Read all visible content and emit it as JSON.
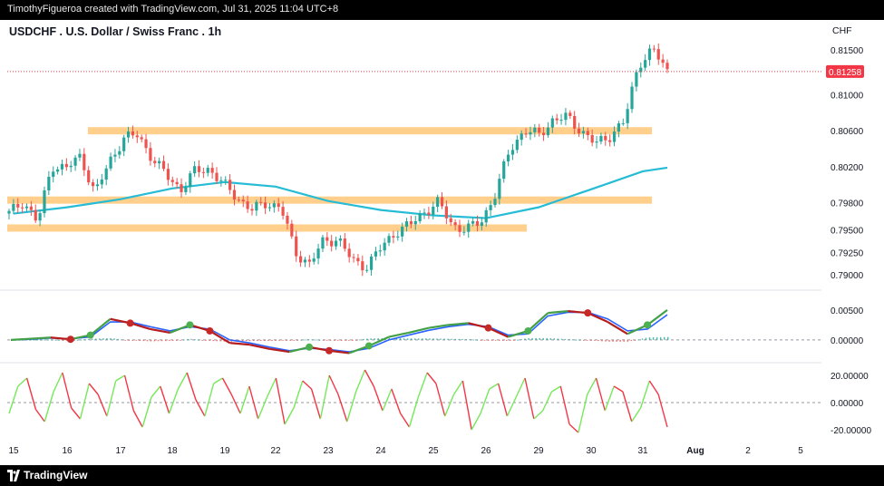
{
  "header": {
    "attribution": "TimothyFigueroa created with TradingView.com, Jul 31, 2025 11:04 UTC+8"
  },
  "footer": {
    "brand": "TradingView"
  },
  "colors": {
    "up": "#26a69a",
    "down": "#ef5350",
    "ma": "#26bcd5",
    "zone": "#ffc777",
    "last_price": "#f23645",
    "macd_fast": "#43a047",
    "macd_slow": "#2962ff",
    "osc_up": "#76e85a",
    "osc_down": "#f23645"
  },
  "chart_data": [
    {
      "type": "candlestick",
      "title": "USDCHF . U.S. Dollar / Swiss Franc . 1h",
      "currency": "CHF",
      "last_price": "0.81258",
      "x_ticks": [
        "15",
        "16",
        "17",
        "18",
        "19",
        "22",
        "23",
        "24",
        "25",
        "26",
        "29",
        "30",
        "31",
        "Aug",
        "2",
        "5"
      ],
      "y_ticks": [
        "0.81500",
        "0.81000",
        "0.80600",
        "0.80200",
        "0.79800",
        "0.79500",
        "0.79250",
        "0.79000"
      ],
      "ylim": [
        0.7885,
        0.817
      ],
      "grid": false,
      "price_path": [
        [
          "15",
          0.7968
        ],
        [
          "15",
          0.7982
        ],
        [
          "16",
          0.7958
        ],
        [
          "16",
          0.8022
        ],
        [
          "16",
          0.8018
        ],
        [
          "17",
          0.8032
        ],
        [
          "17",
          0.799
        ],
        [
          "17",
          0.8025
        ],
        [
          "18",
          0.8052
        ],
        [
          "18",
          0.8055
        ],
        [
          "18",
          0.803
        ],
        [
          "19",
          0.801
        ],
        [
          "19",
          0.7995
        ],
        [
          "19",
          0.8015
        ],
        [
          "19",
          0.8018
        ],
        [
          "22",
          0.8
        ],
        [
          "22",
          0.7985
        ],
        [
          "22",
          0.7972
        ],
        [
          "22",
          0.798
        ],
        [
          "22",
          0.7975
        ],
        [
          "23",
          0.7925
        ],
        [
          "23",
          0.7912
        ],
        [
          "23",
          0.7938
        ],
        [
          "24",
          0.794
        ],
        [
          "24",
          0.7915
        ],
        [
          "24",
          0.791
        ],
        [
          "25",
          0.793
        ],
        [
          "25",
          0.7948
        ],
        [
          "25",
          0.7955
        ],
        [
          "25",
          0.797
        ],
        [
          "26",
          0.798
        ],
        [
          "26",
          0.7955
        ],
        [
          "26",
          0.795
        ],
        [
          "26",
          0.796
        ],
        [
          "26",
          0.799
        ],
        [
          "29",
          0.804
        ],
        [
          "29",
          0.806
        ],
        [
          "29",
          0.8055
        ],
        [
          "29",
          0.8072
        ],
        [
          "30",
          0.8075
        ],
        [
          "30",
          0.806
        ],
        [
          "30",
          0.8045
        ],
        [
          "30",
          0.8055
        ],
        [
          "31",
          0.807
        ],
        [
          "31",
          0.8135
        ],
        [
          "31",
          0.815
        ],
        [
          "31",
          0.8126
        ]
      ],
      "moving_average": [
        [
          "15",
          0.7968
        ],
        [
          "16",
          0.7975
        ],
        [
          "17",
          0.7984
        ],
        [
          "18",
          0.7996
        ],
        [
          "19",
          0.8003
        ],
        [
          "22",
          0.7998
        ],
        [
          "23",
          0.7982
        ],
        [
          "24",
          0.7972
        ],
        [
          "25",
          0.7966
        ],
        [
          "26",
          0.7963
        ],
        [
          "29",
          0.7975
        ],
        [
          "30",
          0.7995
        ],
        [
          "31",
          0.8015
        ]
      ],
      "zones": [
        {
          "from": "15",
          "to": "31",
          "level": 0.806
        },
        {
          "from": "15",
          "to": "31",
          "level": 0.7983
        },
        {
          "from": "15",
          "to": "29",
          "level": 0.7952
        }
      ]
    },
    {
      "type": "line",
      "y_ticks": [
        "0.00500",
        "0.00000"
      ],
      "ylim": [
        -0.0035,
        0.008
      ],
      "series": [
        {
          "values": [
            0.0,
            0.0002,
            0.0004,
            0.0001,
            0.0008,
            0.0035,
            0.0028,
            0.0018,
            0.0012,
            0.0025,
            0.0015,
            -0.0005,
            -0.0008,
            -0.0015,
            -0.002,
            -0.0012,
            -0.0018,
            -0.0022,
            -0.001,
            0.0005,
            0.0012,
            0.002,
            0.0025,
            0.0028,
            0.002,
            0.0005,
            0.0015,
            0.0045,
            0.0048,
            0.0045,
            0.003,
            0.001,
            0.0025,
            0.005
          ]
        },
        {
          "values": [
            0.0,
            0.0001,
            0.0003,
            0.0002,
            0.0005,
            0.003,
            0.003,
            0.0022,
            0.0015,
            0.0022,
            0.0018,
            0.0,
            -0.0005,
            -0.0012,
            -0.0018,
            -0.0014,
            -0.0016,
            -0.002,
            -0.0014,
            0.0,
            0.0008,
            0.0016,
            0.0022,
            0.0026,
            0.0022,
            0.0008,
            0.001,
            0.004,
            0.0046,
            0.0046,
            0.0035,
            0.0015,
            0.0018,
            0.0042
          ]
        }
      ]
    },
    {
      "type": "line",
      "y_ticks": [
        "20.00000",
        "0.00000",
        "-20.00000"
      ],
      "ylim": [
        -28,
        28
      ],
      "series": [
        {
          "values": [
            -8,
            12,
            18,
            -5,
            -14,
            8,
            22,
            -4,
            -12,
            14,
            6,
            -10,
            16,
            20,
            -6,
            -18,
            4,
            12,
            -8,
            10,
            22,
            2,
            -10,
            14,
            18,
            6,
            -8,
            12,
            -12,
            4,
            18,
            -16,
            -4,
            16,
            10,
            -12,
            20,
            6,
            -14,
            8,
            24,
            12,
            -6,
            10,
            -8,
            -18,
            4,
            22,
            14,
            -10,
            6,
            16,
            -20,
            -8,
            10,
            14,
            -10,
            4,
            18,
            -12,
            -6,
            8,
            12,
            -16,
            -22,
            6,
            18,
            -6,
            12,
            8,
            -14,
            -4,
            16,
            6,
            -18
          ]
        }
      ]
    }
  ]
}
